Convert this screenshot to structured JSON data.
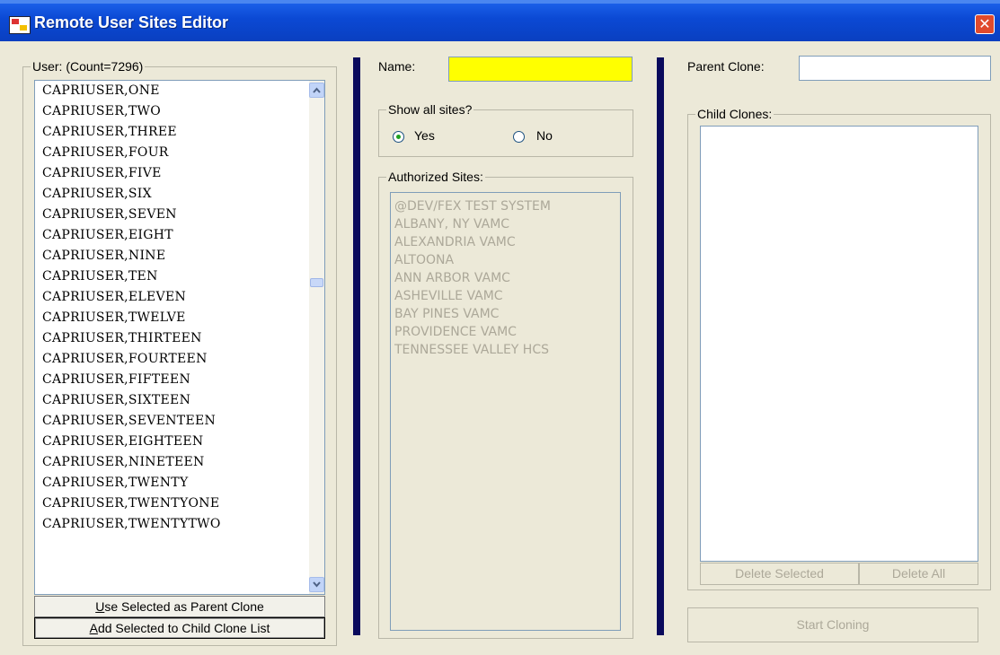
{
  "window": {
    "title": "Remote User Sites Editor",
    "close_glyph": "✕"
  },
  "user_group": {
    "legend": "User:  (Count=7296)"
  },
  "users": [
    "CAPRIUSER,ONE",
    "CAPRIUSER,TWO",
    "CAPRIUSER,THREE",
    "CAPRIUSER,FOUR",
    "CAPRIUSER,FIVE",
    "CAPRIUSER,SIX",
    "CAPRIUSER,SEVEN",
    "CAPRIUSER,EIGHT",
    "CAPRIUSER,NINE",
    "CAPRIUSER,TEN",
    "CAPRIUSER,ELEVEN",
    "CAPRIUSER,TWELVE",
    "CAPRIUSER,THIRTEEN",
    "CAPRIUSER,FOURTEEN",
    "CAPRIUSER,FIFTEEN",
    "CAPRIUSER,SIXTEEN",
    "CAPRIUSER,SEVENTEEN",
    "CAPRIUSER,EIGHTEEN",
    "CAPRIUSER,NINETEEN",
    "CAPRIUSER,TWENTY",
    "CAPRIUSER,TWENTYONE",
    "CAPRIUSER,TWENTYTWO"
  ],
  "user_buttons": {
    "use_parent_key": "U",
    "use_parent_rest": "se Selected as Parent Clone",
    "add_child_key": "A",
    "add_child_rest": "dd Selected to Child Clone List"
  },
  "name_field": {
    "label": "Name:",
    "value": ""
  },
  "show_all": {
    "legend": "Show all sites?",
    "yes": "Yes",
    "no": "No",
    "selected": "Yes"
  },
  "authorized_sites": {
    "legend": "Authorized Sites:",
    "items": [
      "@DEV/FEX TEST SYSTEM",
      "ALBANY, NY VAMC",
      "ALEXANDRIA VAMC",
      "ALTOONA",
      "ANN ARBOR VAMC",
      "ASHEVILLE VAMC",
      "BAY PINES VAMC",
      "PROVIDENCE VAMC",
      "TENNESSEE VALLEY HCS"
    ]
  },
  "parent_clone": {
    "label": "Parent Clone:",
    "value": ""
  },
  "child_clones": {
    "legend": "Child Clones:",
    "delete_selected": "Delete Selected",
    "delete_all": "Delete All"
  },
  "start_cloning": "Start Cloning",
  "colors": {
    "name_field_bg": "#ffff00",
    "title_bar": "#0b49d4",
    "separator": "#0a0a5c",
    "disabled_text": "#aca899"
  }
}
